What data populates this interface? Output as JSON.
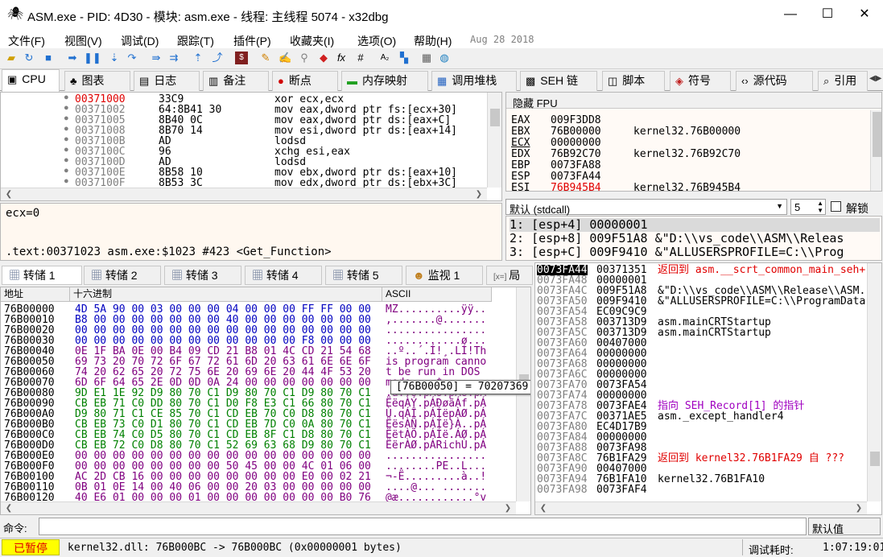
{
  "window": {
    "title": "ASM.exe - PID: 4D30 - 模块: asm.exe - 线程: 主线程 5074 - x32dbg",
    "min": "—",
    "max": "☐",
    "close": "✕"
  },
  "menu": [
    "文件(F)",
    "视图(V)",
    "调试(D)",
    "跟踪(T)",
    "插件(P)",
    "收藏夹(I)",
    "选项(O)",
    "帮助(H)"
  ],
  "build_date": "Aug 28 2018",
  "toolbar": [
    "folder-open-icon",
    "restart-icon",
    "stop-icon",
    "run-icon",
    "pause-icon",
    "step-into-icon",
    "step-over-icon",
    "trace-into-icon",
    "trace-over-icon",
    "execute-till-return-icon",
    "run-to-user-code-icon",
    "record-icon",
    "pencil-icon",
    "comment-icon",
    "label-icon",
    "bookmark-icon",
    "function-icon",
    "hash-icon",
    "font-icon",
    "calculator-icon",
    "globe-icon"
  ],
  "tabs": [
    {
      "label": "CPU",
      "icon": "▣"
    },
    {
      "label": "图表",
      "icon": "♣"
    },
    {
      "label": "日志",
      "icon": "▤"
    },
    {
      "label": "备注",
      "icon": "▥"
    },
    {
      "label": "断点",
      "icon": "●"
    },
    {
      "label": "内存映射",
      "icon": "▬"
    },
    {
      "label": "调用堆栈",
      "icon": "▦"
    },
    {
      "label": "SEH 链",
      "icon": "▩"
    },
    {
      "label": "脚本",
      "icon": "◫"
    },
    {
      "label": "符号",
      "icon": "◈"
    },
    {
      "label": "源代码",
      "icon": "‹›"
    },
    {
      "label": "引用",
      "icon": "⌕"
    }
  ],
  "disasm": [
    {
      "addr": "00371000",
      "bytes": "33C9",
      "asm": "xor ecx,ecx"
    },
    {
      "addr": "00371002",
      "bytes": "64:8B41 30",
      "asm": "mov eax,dword ptr fs:[ecx+30]"
    },
    {
      "addr": "00371005",
      "bytes": "8B40 0C",
      "asm": "mov eax,dword ptr ds:[eax+C]"
    },
    {
      "addr": "00371008",
      "bytes": "8B70 14",
      "asm": "mov esi,dword ptr ds:[eax+14]"
    },
    {
      "addr": "0037100B",
      "bytes": "AD",
      "asm": "lodsd"
    },
    {
      "addr": "0037100C",
      "bytes": "96",
      "asm": "xchg esi,eax"
    },
    {
      "addr": "0037100D",
      "bytes": "AD",
      "asm": "lodsd"
    },
    {
      "addr": "0037100E",
      "bytes": "8B58 10",
      "asm": "mov ebx,dword ptr ds:[eax+10]"
    },
    {
      "addr": "0037100F",
      "bytes": "8B53 3C",
      "asm": "mov edx,dword ptr ds:[ebx+3C]"
    },
    {
      "addr": "00371012",
      "bytes": "",
      "asm": ""
    }
  ],
  "info": {
    "line1": "ecx=0",
    "line2": ".text:00371023 asm.exe:$1023 #423 <Get_Function>"
  },
  "regs": {
    "header": "隐藏 FPU",
    "items": [
      {
        "name": "EAX",
        "val": "009F3DD8",
        "note": ""
      },
      {
        "name": "EBX",
        "val": "76B00000",
        "note": "kernel32.76B00000"
      },
      {
        "name": "ECX",
        "val": "00000000",
        "note": ""
      },
      {
        "name": "EDX",
        "val": "76B92C70",
        "note": "kernel32.76B92C70"
      },
      {
        "name": "EBP",
        "val": "0073FA88",
        "note": ""
      },
      {
        "name": "ESP",
        "val": "0073FA44",
        "note": ""
      },
      {
        "name": "ESI",
        "val": "76B945B4",
        "note": "kernel32.76B945B4"
      }
    ]
  },
  "callconv": {
    "value": "默认 (stdcall)",
    "count": "5",
    "unlock": "解锁"
  },
  "args": [
    "1: [esp+4] 00000001",
    "2: [esp+8] 009F51A8 &\"D:\\\\vs_code\\\\ASM\\\\Releas",
    "3: [esp+C] 009F9410 &\"ALLUSERSPROFILE=C:\\\\Prog"
  ],
  "dumptabs": [
    "转储 1",
    "转储 2",
    "转储 3",
    "转储 4",
    "转储 5",
    "监视 1",
    "局"
  ],
  "dump": {
    "h_addr": "地址",
    "h_hex": "十六进制",
    "h_ascii": "ASCII",
    "rows": [
      {
        "a": "76B00000",
        "h": "4D 5A 90 00 03 00 00 00 04 00 00 00 FF FF 00 00",
        "s": "MZ..........ÿÿ.."
      },
      {
        "a": "76B00010",
        "h": "B8 00 00 00 00 00 00 00 40 00 00 00 00 00 00 00",
        "s": ",.......@......."
      },
      {
        "a": "76B00020",
        "h": "00 00 00 00 00 00 00 00 00 00 00 00 00 00 00 00",
        "s": "................"
      },
      {
        "a": "76B00030",
        "h": "00 00 00 00 00 00 00 00 00 00 00 00 F8 00 00 00",
        "s": "............ø..."
      },
      {
        "a": "76B00040",
        "h": "0E 1F BA 0E 00 B4 09 CD 21 B8 01 4C CD 21 54 68",
        "s": "..º..´.Í!¸.LÍ!Th"
      },
      {
        "a": "76B00050",
        "h": "69 73 20 70 72 6F 67 72 61 6D 20 63 61 6E 6E 6F",
        "s": "is program canno"
      },
      {
        "a": "76B00060",
        "h": "74 20 62 65 20 72 75 6E 20 69 6E 20 44 4F 53 20",
        "s": "t be run in DOS "
      },
      {
        "a": "76B00070",
        "h": "6D 6F 64 65 2E 0D 0D 0A 24 00 00 00 00 00 00 00",
        "s": "mode....$......."
      },
      {
        "a": "76B00080",
        "h": "9D E1 1E 92 D9 80 70 C1 D9 80 70 C1 D9 80 70 C1",
        "s": ".á..Ù.pÁÙ.pÁÙ.pÁ"
      },
      {
        "a": "76B00090",
        "h": "CB EB 71 C0 DD 80 70 C1 D0 F8 E3 C1 66 80 70 C1",
        "s": "ËëqÀÝ.pÁÐøãÁf.pÁ"
      },
      {
        "a": "76B000A0",
        "h": "D9 80 71 C1 CE 85 70 C1 CD EB 70 C0 D8 80 70 C1",
        "s": "Ù.qÁÎ.pÁÍëpÀØ.pÁ"
      },
      {
        "a": "76B000B0",
        "h": "CB EB 73 C0 D1 80 70 C1 CD EB 7D C0 0A 80 70 C1",
        "s": "ËësÀÑ.pÁÍë}À..pÁ"
      },
      {
        "a": "76B000C0",
        "h": "CB EB 74 C0 D5 80 70 C1 CD EB 8F C1 D8 80 70 C1",
        "s": "ËëtÀÕ.pÁÍë.ÁØ.pÁ"
      },
      {
        "a": "76B000D0",
        "h": "CB EB 72 C0 D8 80 70 C1 52 69 63 68 D9 80 70 C1",
        "s": "ËërÀØ.pÁRichÙ.pÁ"
      },
      {
        "a": "76B000E0",
        "h": "00 00 00 00 00 00 00 00 00 00 00 00 00 00 00 00",
        "s": "................"
      },
      {
        "a": "76B000F0",
        "h": "00 00 00 00 00 00 00 00 50 45 00 00 4C 01 06 00",
        "s": "........PE..L..."
      },
      {
        "a": "76B00100",
        "h": "AC 2D CB 16 00 00 00 00 00 00 00 00 E0 00 02 21",
        "s": "¬-Ë.........à..!"
      },
      {
        "a": "76B00110",
        "h": "0B 01 0E 14 00 40 06 00 00 20 03 00 00 00 00 00",
        "s": "....@... ......."
      },
      {
        "a": "76B00120",
        "h": "40 E6 01 00 00 00 01 00 00 00 00 00 00 00 B0 76",
        "s": "@æ............°v"
      }
    ]
  },
  "tooltip": "[76B00050] = 70207369 (系统数据)",
  "stack": [
    {
      "a": "0073FA44",
      "v": "00371351",
      "c": "返回到 asm.__scrt_common_main_seh+",
      "cls": "red"
    },
    {
      "a": "0073FA48",
      "v": "00000001",
      "c": "",
      "cls": ""
    },
    {
      "a": "0073FA4C",
      "v": "009F51A8",
      "c": "&\"D:\\\\vs_code\\\\ASM\\\\Release\\\\ASM.",
      "cls": ""
    },
    {
      "a": "0073FA50",
      "v": "009F9410",
      "c": "&\"ALLUSERSPROFILE=C:\\\\ProgramData",
      "cls": ""
    },
    {
      "a": "0073FA54",
      "v": "EC09C9C9",
      "c": "",
      "cls": ""
    },
    {
      "a": "0073FA58",
      "v": "003713D9",
      "c": "asm.mainCRTStartup",
      "cls": ""
    },
    {
      "a": "0073FA5C",
      "v": "003713D9",
      "c": "asm.mainCRTStartup",
      "cls": ""
    },
    {
      "a": "0073FA60",
      "v": "00407000",
      "c": "",
      "cls": ""
    },
    {
      "a": "0073FA64",
      "v": "00000000",
      "c": "",
      "cls": ""
    },
    {
      "a": "0073FA68",
      "v": "00000000",
      "c": "",
      "cls": ""
    },
    {
      "a": "0073FA6C",
      "v": "00000000",
      "c": "",
      "cls": ""
    },
    {
      "a": "0073FA70",
      "v": "0073FA54",
      "c": "",
      "cls": ""
    },
    {
      "a": "0073FA74",
      "v": "00000000",
      "c": "",
      "cls": ""
    },
    {
      "a": "0073FA78",
      "v": "0073FAE4",
      "c": "指向 SEH_Record[1] 的指针",
      "cls": "purple"
    },
    {
      "a": "0073FA7C",
      "v": "00371AE5",
      "c": "asm._except_handler4",
      "cls": ""
    },
    {
      "a": "0073FA80",
      "v": "EC4D17B9",
      "c": "",
      "cls": ""
    },
    {
      "a": "0073FA84",
      "v": "00000000",
      "c": "",
      "cls": ""
    },
    {
      "a": "0073FA88",
      "v": "0073FA98",
      "c": "",
      "cls": ""
    },
    {
      "a": "0073FA8C",
      "v": "76B1FA29",
      "c": "返回到 kernel32.76B1FA29 自 ???",
      "cls": "red"
    },
    {
      "a": "0073FA90",
      "v": "00407000",
      "c": "",
      "cls": ""
    },
    {
      "a": "0073FA94",
      "v": "76B1FA10",
      "c": "kernel32.76B1FA10",
      "cls": ""
    },
    {
      "a": "0073FA98",
      "v": "0073FAF4",
      "c": "",
      "cls": ""
    }
  ],
  "cmd": {
    "label": "命令:",
    "default": "默认值"
  },
  "status": {
    "state": "已暂停",
    "text": "kernel32.dll: 76B000BC -> 76B000BC (0x00000001 bytes)",
    "time_label": "调试耗时:",
    "time": "1:07:19:01"
  }
}
